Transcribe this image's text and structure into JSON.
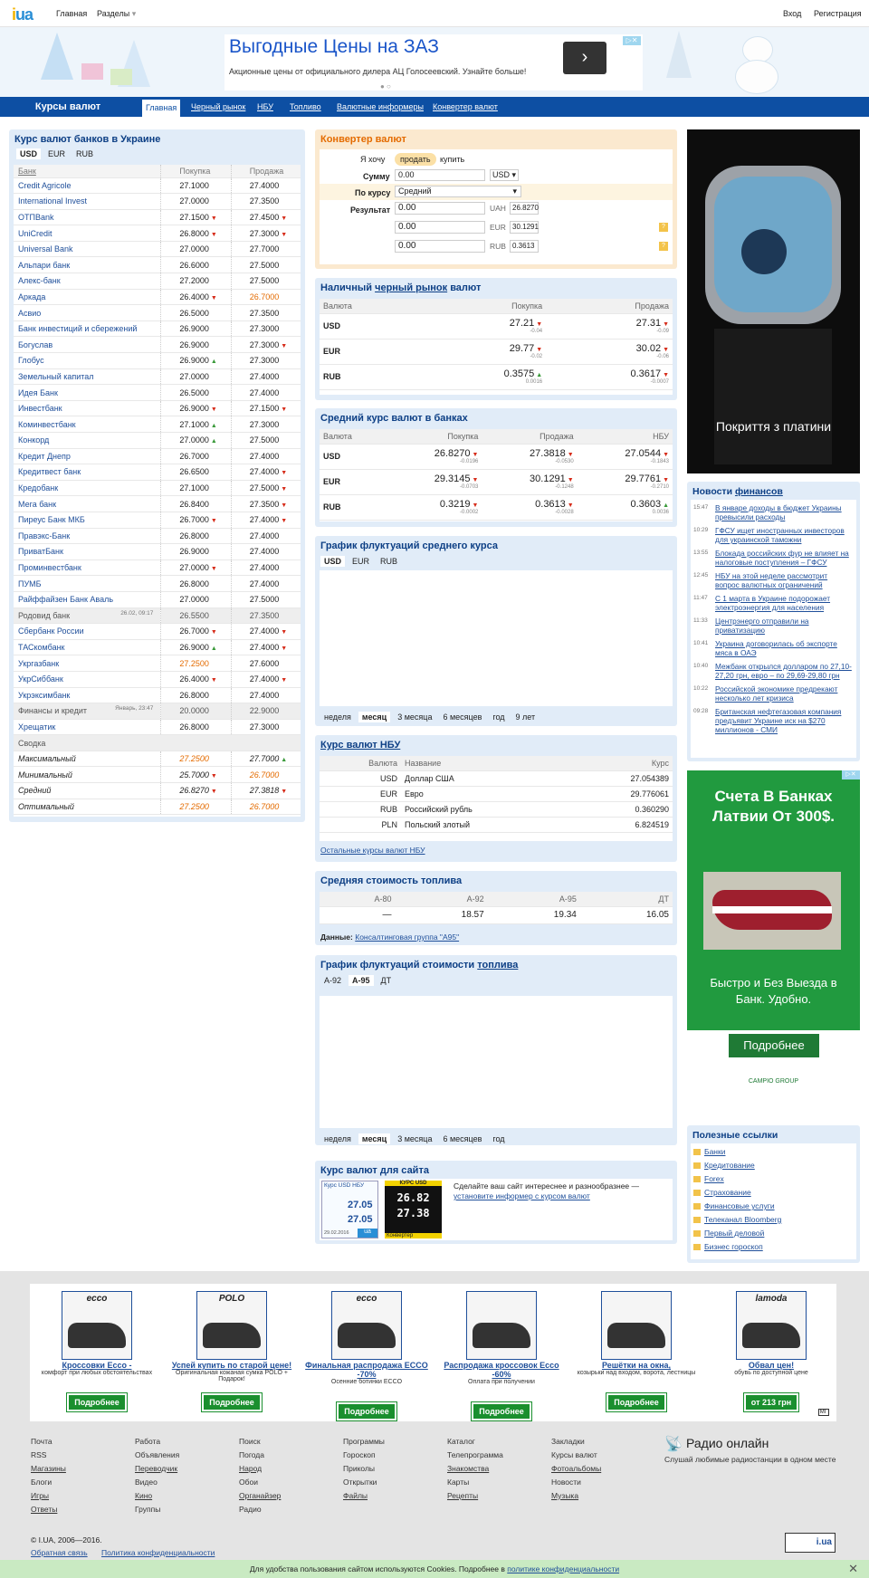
{
  "header": {
    "logo": "i.ua",
    "nav": [
      "Главная",
      "Разделы"
    ],
    "login": "Вход",
    "register": "Регистрация"
  },
  "ad": {
    "title": "Выгодные Цены на ЗАЗ",
    "subtitle": "Акционные цены от официального дилера АЦ Голосеевский. Узнайте больше!"
  },
  "navbar": {
    "title": "Курсы валют",
    "items": [
      "Главная",
      "Черный рынок",
      "НБУ",
      "Топливо",
      "Валютные информеры",
      "Конвертер валют"
    ]
  },
  "banks": {
    "title": "Курс валют банков в Украине",
    "tabs": [
      "USD",
      "EUR",
      "RUB"
    ],
    "headers": [
      "Банк",
      "Покупка",
      "Продажа"
    ],
    "rows": [
      [
        "Credit Agricole",
        "",
        "27.1000",
        "",
        "27.4000",
        ""
      ],
      [
        "International Invest",
        "",
        "27.0000",
        "",
        "27.3500",
        ""
      ],
      [
        "ОТПBank",
        "",
        "27.1500",
        "dn",
        "27.4500",
        "dn"
      ],
      [
        "UniCredit",
        "",
        "26.8000",
        "dn",
        "27.3000",
        "dn"
      ],
      [
        "Universal Bank",
        "",
        "27.0000",
        "",
        "27.7000",
        ""
      ],
      [
        "Альпари банк",
        "",
        "26.6000",
        "",
        "27.5000",
        ""
      ],
      [
        "Алекс-банк",
        "",
        "27.2000",
        "",
        "27.5000",
        ""
      ],
      [
        "Аркада",
        "",
        "26.4000",
        "dn",
        "26.7000",
        "org"
      ],
      [
        "Асвио",
        "",
        "26.5000",
        "",
        "27.3500",
        ""
      ],
      [
        "Банк инвестиций и сбережений",
        "",
        "26.9000",
        "",
        "27.3000",
        ""
      ],
      [
        "Богуслав",
        "",
        "26.9000",
        "",
        "27.3000",
        "dn"
      ],
      [
        "Глобус",
        "",
        "26.9000",
        "up",
        "27.3000",
        ""
      ],
      [
        "Земельный капитал",
        "",
        "27.0000",
        "",
        "27.4000",
        ""
      ],
      [
        "Идея Банк",
        "",
        "26.5000",
        "",
        "27.4000",
        ""
      ],
      [
        "Инвестбанк",
        "",
        "26.9000",
        "dn",
        "27.1500",
        "dn"
      ],
      [
        "Коминвестбанк",
        "",
        "27.1000",
        "up",
        "27.3000",
        ""
      ],
      [
        "Конкорд",
        "",
        "27.0000",
        "up",
        "27.5000",
        ""
      ],
      [
        "Кредит Днепр",
        "",
        "26.7000",
        "",
        "27.4000",
        ""
      ],
      [
        "Кредитвест банк",
        "",
        "26.6500",
        "",
        "27.4000",
        "dn"
      ],
      [
        "Кредобанк",
        "",
        "27.1000",
        "",
        "27.5000",
        "dn"
      ],
      [
        "Мега банк",
        "",
        "26.8400",
        "",
        "27.3500",
        "dn"
      ],
      [
        "Пиреус Банк МКБ",
        "",
        "26.7000",
        "dn",
        "27.4000",
        "dn"
      ],
      [
        "Правэкс-Банк",
        "",
        "26.8000",
        "",
        "27.4000",
        ""
      ],
      [
        "ПриватБанк",
        "",
        "26.9000",
        "",
        "27.4000",
        ""
      ],
      [
        "Проминвестбанк",
        "",
        "27.0000",
        "dn",
        "27.4000",
        ""
      ],
      [
        "ПУМБ",
        "",
        "26.8000",
        "",
        "27.4000",
        ""
      ],
      [
        "Райффайзен Банк Аваль",
        "",
        "27.0000",
        "",
        "27.5000",
        ""
      ],
      [
        "Родовид банк",
        "26.02, 09:17",
        "26.5500",
        "grey",
        "27.3500",
        "grey"
      ],
      [
        "Сбербанк России",
        "",
        "26.7000",
        "dn",
        "27.4000",
        "dn"
      ],
      [
        "ТАСкомбанк",
        "",
        "26.9000",
        "up",
        "27.4000",
        "dn"
      ],
      [
        "Укргазбанк",
        "",
        "27.2500",
        "org",
        "27.6000",
        ""
      ],
      [
        "УкрСиббанк",
        "",
        "26.4000",
        "dn",
        "27.4000",
        "dn"
      ],
      [
        "Укрэксимбанк",
        "",
        "26.8000",
        "",
        "27.4000",
        ""
      ],
      [
        "Финансы и кредит",
        "Январь, 23:47",
        "20.0000",
        "grey",
        "22.9000",
        "grey"
      ],
      [
        "Хрещатик",
        "",
        "26.8000",
        "",
        "27.3000",
        ""
      ]
    ],
    "summary_label": "Сводка",
    "summary": [
      [
        "Максимальный",
        "27.2500",
        "org",
        "27.7000",
        "up"
      ],
      [
        "Минимальный",
        "25.7000",
        "dn",
        "26.7000",
        "org"
      ],
      [
        "Средний",
        "26.8270",
        "dn",
        "27.3818",
        "dn"
      ],
      [
        "Оптимальный",
        "27.2500",
        "org",
        "26.7000",
        "org"
      ]
    ]
  },
  "converter": {
    "title": "Конвертер валют",
    "want": "Я хочу",
    "sell": "продать",
    "buy": "купить",
    "sum": "Сумму",
    "sum_value": "0.00",
    "currency": "USD",
    "rate_label": "По курсу",
    "rate_value": "Средний",
    "result": "Результат",
    "results": [
      [
        "0.00",
        "UAH",
        "26.8270"
      ],
      [
        "0.00",
        "EUR",
        "30.1291"
      ],
      [
        "0.00",
        "RUB",
        "0.3613"
      ]
    ]
  },
  "black": {
    "title_pre": "Наличный",
    "title_link": "черный рынок",
    "title_post": "валют",
    "headers": [
      "Валюта",
      "Покупка",
      "Продажа"
    ],
    "rows": [
      [
        "USD",
        "27.21",
        "dn",
        "-0.04",
        "27.31",
        "dn",
        "-0.09"
      ],
      [
        "EUR",
        "29.77",
        "dn",
        "-0.02",
        "30.02",
        "dn",
        "-0.06"
      ],
      [
        "RUB",
        "0.3575",
        "up",
        "0.0016",
        "0.3617",
        "dn",
        "-0.0007"
      ]
    ]
  },
  "avg": {
    "title": "Средний курс валют в банках",
    "headers": [
      "Валюта",
      "Покупка",
      "Продажа",
      "НБУ"
    ],
    "rows": [
      [
        "USD",
        "26.8270",
        "dn",
        "-0.0196",
        "27.3818",
        "dn",
        "-0.0530",
        "27.0544",
        "dn",
        "-0.1843"
      ],
      [
        "EUR",
        "29.3145",
        "dn",
        "-0.0703",
        "30.1291",
        "dn",
        "-0.1248",
        "29.7761",
        "dn",
        "-0.2710"
      ],
      [
        "RUB",
        "0.3219",
        "dn",
        "-0.0002",
        "0.3613",
        "dn",
        "-0.0028",
        "0.3603",
        "up",
        "0.0036"
      ]
    ]
  },
  "chart1": {
    "title": "График флуктуаций среднего курса",
    "tabs": [
      "USD",
      "EUR",
      "RUB"
    ],
    "periods": [
      "неделя",
      "месяц",
      "3 месяца",
      "6 месяцев",
      "год",
      "9 лет"
    ]
  },
  "nbu": {
    "title": "Курс валют НБУ",
    "headers": [
      "Валюта",
      "Название",
      "Курс"
    ],
    "rows": [
      [
        "USD",
        "Доллар США",
        "27.054389"
      ],
      [
        "EUR",
        "Евро",
        "29.776061"
      ],
      [
        "RUB",
        "Российский рубль",
        "0.360290"
      ],
      [
        "PLN",
        "Польский злотый",
        "6.824519"
      ]
    ],
    "more": "Остальные курсы валют НБУ"
  },
  "fuel": {
    "title": "Средняя стоимость топлива",
    "headers": [
      "А-80",
      "А-92",
      "А-95",
      "ДТ"
    ],
    "values": [
      "—",
      "18.57",
      "19.34",
      "16.05"
    ],
    "source_label": "Данные:",
    "source": "Консалтинговая группа \"А95\""
  },
  "chart2": {
    "title_pre": "График флуктуаций стоимости",
    "title_link": "топлива",
    "tabs": [
      "А-92",
      "А-95",
      "ДТ"
    ],
    "periods": [
      "неделя",
      "месяц",
      "3 месяца",
      "6 месяцев",
      "год"
    ]
  },
  "informer": {
    "title": "Курс валют для сайта",
    "text": "Сделайте ваш сайт интереснее и разнообразнее —",
    "link": "установите информер с курсом валют",
    "w1_title": "Курс USD НБУ",
    "w1_v1": "27.05",
    "w1_v2": "27.05",
    "w1_date": "29.02.2016",
    "w2_title": "КУРС USD",
    "w2_v1": "26.82",
    "w2_v2": "27.38",
    "w2_btn": "Конвертер"
  },
  "sidead": {
    "caption": "Покриття з платини"
  },
  "news": {
    "title_pre": "Новости",
    "title_link": "финансов",
    "items": [
      [
        "15:47",
        "В январе доходы в бюджет Украины превысили расходы"
      ],
      [
        "10:29",
        "ГФСУ ищет иностранных инвесторов для украинской таможни"
      ],
      [
        "13:55",
        "Блокада российских фур не влияет на налоговые поступления – ГФСУ"
      ],
      [
        "12:45",
        "НБУ на этой неделе рассмотрит вопрос валютных ограничений"
      ],
      [
        "11:47",
        "С 1 марта в Украине подорожает электроэнергия для населения"
      ],
      [
        "11:33",
        "Центрэнерго отправили на приватизацию"
      ],
      [
        "10:41",
        "Украина договорилась об экспорте мяса в ОАЭ"
      ],
      [
        "10:40",
        "Межбанк открылся долларом по 27,10-27,20 грн, евро – по 29,69-29,80 грн"
      ],
      [
        "10:22",
        "Российской экономике предрекают несколько лет кризиса"
      ],
      [
        "09:28",
        "Британская нефтегазовая компания предъявит Украине иск на $270 миллионов - СМИ"
      ]
    ]
  },
  "sidead2": {
    "title": "Счета В Банках Латвии От 300$.",
    "sub": "Быстро и Без Выезда в Банк. Удобно.",
    "btn": "Подробнее",
    "brand": "CAMPIO GROUP"
  },
  "useful": {
    "title": "Полезные ссылки",
    "items": [
      "Банки",
      "Кредитование",
      "Forex",
      "Страхование",
      "Финансовые услуги",
      "Телеканал Bloomberg",
      "Первый деловой",
      "Бизнес гороскоп"
    ]
  },
  "promo": [
    {
      "title": "Кроссовки Ecco -",
      "desc": "комфорт при любых обстоятельствах",
      "btn": "Подробнее",
      "brand": "ecco"
    },
    {
      "title": "Успей купить по старой цене!",
      "desc": "Оригинальная кожаная сумка POLO + Подарок!",
      "btn": "Подробнее",
      "brand": "POLO"
    },
    {
      "title": "Финальная распродажа ECCO -70%",
      "desc": "Осенние ботинки ECCO",
      "btn": "Подробнее",
      "brand": "ecco"
    },
    {
      "title": "Распродажа кроссовок Ecco -60%",
      "desc": "Оплата при получении",
      "btn": "Подробнее",
      "brand": ""
    },
    {
      "title": "Решётки на окна,",
      "desc": "козырьки над входом, ворота, лестницы",
      "btn": "Подробнее",
      "brand": ""
    },
    {
      "title": "Обвал цен!",
      "desc": "обувь по доступной цене",
      "btn": "от 213 грн",
      "brand": "lamoda"
    }
  ],
  "footer": {
    "cols": [
      [
        "Почта",
        "RSS",
        "Магазины",
        "Блоги",
        "Игры",
        "Ответы"
      ],
      [
        "Работа",
        "Объявления",
        "Переводчик",
        "Видео",
        "Кино",
        "Группы"
      ],
      [
        "Поиск",
        "Погода",
        "Народ",
        "Обои",
        "Органайзер",
        "Радио"
      ],
      [
        "Программы",
        "Гороскоп",
        "Приколы",
        "Открытки",
        "Файлы"
      ],
      [
        "Каталог",
        "Телепрограмма",
        "Знакомства",
        "Карты",
        "Рецепты"
      ],
      [
        "Закладки",
        "Курсы валют",
        "Фотоальбомы",
        "Новости",
        "Музыка"
      ]
    ],
    "radio_title": "Радио онлайн",
    "radio_sub": "Слушай любимые радиостанции в одном месте",
    "copyright": "© I.UA, 2006—2016.",
    "feedback": "Обратная связь",
    "privacy": "Политика конфиденциальности"
  },
  "cookie": {
    "text": "Для удобства пользования сайтом используются Cookies. Подробнее в",
    "link": "политике конфиденциальности"
  }
}
